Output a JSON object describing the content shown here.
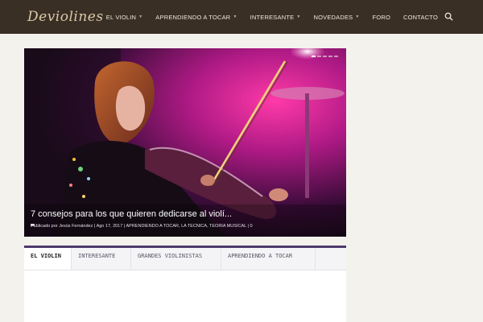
{
  "header": {
    "logo": "Deviolines",
    "nav": [
      {
        "label": "EL VIOLIN",
        "has_submenu": true
      },
      {
        "label": "APRENDIENDO A TOCAR",
        "has_submenu": true
      },
      {
        "label": "INTERESANTE",
        "has_submenu": true
      },
      {
        "label": "NOVEDADES",
        "has_submenu": true
      },
      {
        "label": "FORO",
        "has_submenu": false
      },
      {
        "label": "CONTACTO",
        "has_submenu": false
      }
    ],
    "search_icon": "search-icon",
    "chevron_glyph": "▼"
  },
  "slider": {
    "title": "7 consejos para los que quieren dedicarse al violí...",
    "meta_prefix": "Publicado por",
    "author": "Jesús Fernández",
    "date": "Ago 17, 2017",
    "categories": "APRENDIENDO A TOCAR, LA TECNICA, TEORIA MUSICAL",
    "comments": "0",
    "slides": 5,
    "active_slide": 1
  },
  "tabs": [
    {
      "label": "EL VIOLIN",
      "active": true
    },
    {
      "label": "INTERESANTE",
      "active": false
    },
    {
      "label": "GRANDES VIOLINISTAS",
      "active": false
    },
    {
      "label": "APRENDIENDO A TOCAR",
      "active": false
    }
  ],
  "colors": {
    "header_bg": "#3a2f25",
    "page_bg": "#f3f2ec",
    "accent": "#4c3a6e"
  }
}
